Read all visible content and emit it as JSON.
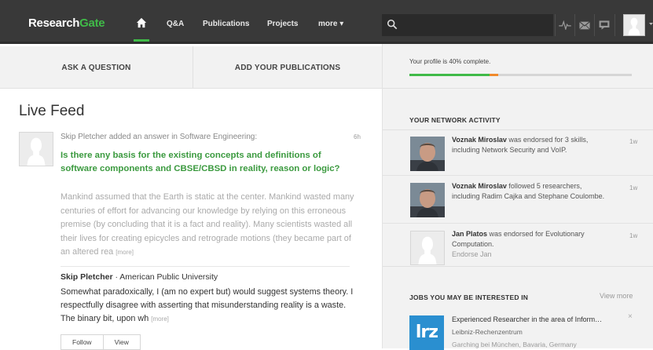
{
  "nav": {
    "logo_main": "Research",
    "logo_accent": "Gate",
    "links": [
      "Q&A",
      "Publications",
      "Projects",
      "more ▾"
    ],
    "search_placeholder": "",
    "icons": [
      "home-icon",
      "search-icon",
      "activity-pulse-icon",
      "messages-icon",
      "notifications-icon",
      "avatar",
      "chevron-down-icon"
    ]
  },
  "actions": {
    "ask": "ASK A QUESTION",
    "add": "ADD YOUR PUBLICATIONS"
  },
  "profile": {
    "text": "Your profile is 40% complete.",
    "progress": 0.4
  },
  "network": {
    "title": "YOUR NETWORK ACTIVITY",
    "items": [
      {
        "name": "Voznak Miroslav",
        "text": " was endorsed for 3 skills, including Network Security and VoIP.",
        "time": "1w"
      },
      {
        "name": "Voznak Miroslav",
        "text": " followed 5 researchers, including Radim Cajka and Stephane Coulombe.",
        "time": "1w"
      },
      {
        "name": "Jan Platos",
        "text": " was endorsed for Evolutionary Computation.",
        "sub": "Endorse Jan",
        "time": "1w"
      }
    ]
  },
  "jobs": {
    "title": "JOBS YOU MAY BE INTERESTED IN",
    "view_more": "View more",
    "items": [
      {
        "logo": "lrz",
        "title": "Experienced Researcher in the area of Inform…",
        "org": "Leibniz-Rechenzentrum",
        "location": "Garching bei München, Bavaria, Germany",
        "close": "×"
      }
    ]
  },
  "feed": {
    "title": "Live Feed",
    "item": {
      "meta": "Skip Pletcher added an answer in Software Engineering:",
      "time": "6h",
      "question": "Is there any basis for the existing concepts and definitions of software components and CBSE/CBSD in reality, reason or logic?",
      "body": "Mankind assumed that the Earth is static at the center. Mankind wasted many centuries of effort for advancing our knowledge by relying on this erroneous premise (by concluding that it is a fact and reality). Many scientists wasted all their lives for creating epicycles and retrograde motions (they became part of an altered rea",
      "more": "[more]",
      "author": "Skip Pletcher",
      "affiliation": " · American Public University",
      "answer": "Somewhat paradoxically, I (am no expert but) would suggest systems theory. I respectfully disagree with asserting that misunderstanding reality is a waste. The binary bit, upon wh",
      "answer_more": "[more]",
      "buttons": [
        "Follow",
        "View"
      ]
    }
  }
}
